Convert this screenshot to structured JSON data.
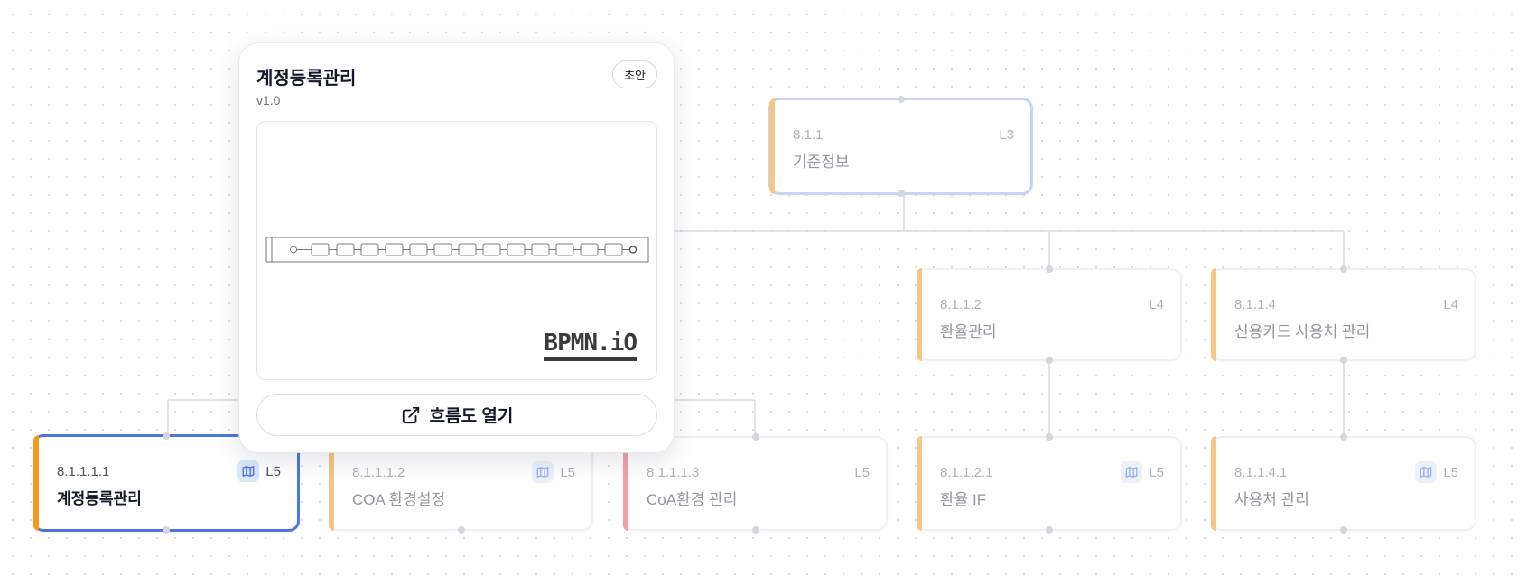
{
  "colors": {
    "accent_orange": "#f4c688",
    "accent_orange_strong": "#f39a1a",
    "accent_pink": "#f2a0b0",
    "selection_blue": "#4f76e0",
    "connector": "#d8dbe0"
  },
  "nodes": [
    {
      "id": "n-811",
      "code": "8.1.1",
      "name": "기준정보",
      "level": "L3"
    },
    {
      "id": "n-8112",
      "code": "8.1.1.2",
      "name": "환율관리",
      "level": "L4"
    },
    {
      "id": "n-8114",
      "code": "8.1.1.4",
      "name": "신용카드 사용처 관리",
      "level": "L4"
    },
    {
      "id": "n-81111",
      "code": "8.1.1.1.1",
      "name": "계정등록관리",
      "level": "L5",
      "icon": "map-icon"
    },
    {
      "id": "n-81112",
      "code": "8.1.1.1.2",
      "name": "COA 환경설정",
      "level": "L5",
      "icon": "map-icon"
    },
    {
      "id": "n-81113",
      "code": "8.1.1.1.3",
      "name": "CoA환경 관리",
      "level": "L5"
    },
    {
      "id": "n-81121",
      "code": "8.1.1.2.1",
      "name": "환율 IF",
      "level": "L5",
      "icon": "map-icon"
    },
    {
      "id": "n-81141",
      "code": "8.1.1.4.1",
      "name": "사용처 관리",
      "level": "L5",
      "icon": "map-icon"
    }
  ],
  "popover": {
    "title": "계정등록관리",
    "version": "v1.0",
    "status_badge": "초안",
    "preview_logo": "BPMN.iO",
    "open_button_label": "흐름도 열기",
    "open_icon": "external-link-icon"
  }
}
